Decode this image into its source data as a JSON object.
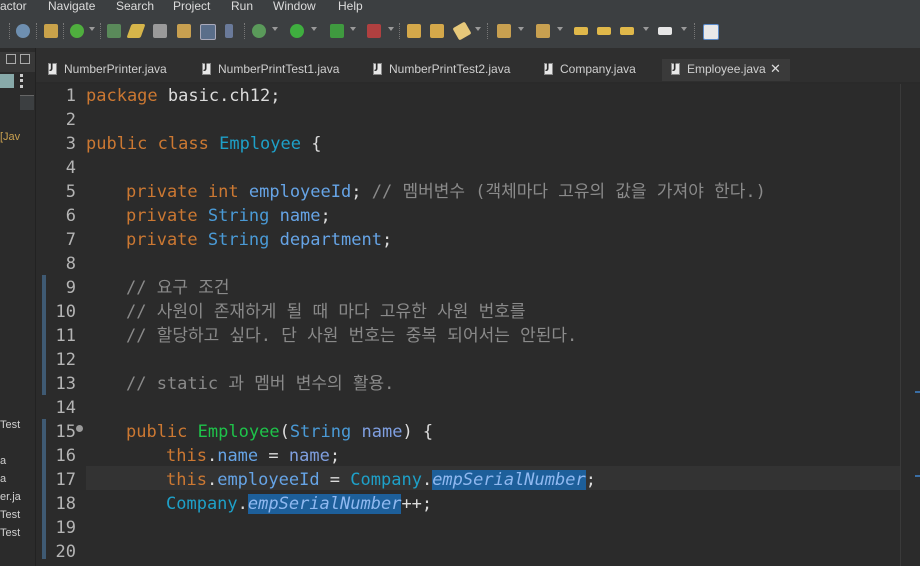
{
  "menubar": {
    "items": [
      "actor",
      "Navigate",
      "Search",
      "Project",
      "Run",
      "Window",
      "Help"
    ]
  },
  "left_panel": {
    "labels": [
      "[Jav",
      "Test",
      "a",
      "a",
      "er.ja",
      "Test",
      "Test"
    ]
  },
  "tabs": [
    {
      "label": "NumberPrinter.java",
      "active": false
    },
    {
      "label": "NumberPrintTest1.java",
      "active": false
    },
    {
      "label": "NumberPrintTest2.java",
      "active": false
    },
    {
      "label": "Company.java",
      "active": false
    },
    {
      "label": "Employee.java",
      "active": true
    }
  ],
  "close_glyph": "✕",
  "editor": {
    "line_numbers": [
      "1",
      "2",
      "3",
      "4",
      "5",
      "6",
      "7",
      "8",
      "9",
      "10",
      "11",
      "12",
      "13",
      "14",
      "15",
      "16",
      "17",
      "18",
      "19",
      "20"
    ],
    "lines": {
      "l1": {
        "kw": "package",
        "rest": " basic.ch12;"
      },
      "l3": {
        "kw1": "public",
        "kw2": "class",
        "cls": "Employee",
        "rest": " {"
      },
      "l5": {
        "kw1": "private",
        "kw2": "int",
        "fld": "employeeId",
        "rest": ";",
        "comment": "// 멤버변수 (객체마다 고유의 값을 가져야 한다.)"
      },
      "l6": {
        "kw": "private",
        "ty": "String",
        "fld": "name",
        "rest": ";"
      },
      "l7": {
        "kw": "private",
        "ty": "String",
        "fld": "department",
        "rest": ";"
      },
      "l9": {
        "comment": "// 요구 조건"
      },
      "l10": {
        "comment": "// 사원이 존재하게 될 때 마다 고유한 사원 번호를"
      },
      "l11": {
        "comment": "// 할당하고 싶다. 단 사원 번호는 중복 되어서는 안된다."
      },
      "l13": {
        "comment": "// static 과 멤버 변수의 활용."
      },
      "l15": {
        "kw": "public",
        "fn": "Employee",
        "p1": "(",
        "ty": "String",
        "pn": "name",
        "p2": ") {"
      },
      "l16": {
        "kw": "this",
        "dot": ".",
        "fld": "name",
        "eq": " = ",
        "pn": "name",
        "rest": ";"
      },
      "l17": {
        "kw": "this",
        "dot": ".",
        "fld": "employeeId",
        "eq": " = ",
        "cls": "Company",
        "dot2": ".",
        "st": "empSerialNumber",
        "rest": ";"
      },
      "l18": {
        "cls": "Company",
        "dot": ".",
        "st": "empSerialNumber",
        "rest": "++;"
      }
    }
  }
}
